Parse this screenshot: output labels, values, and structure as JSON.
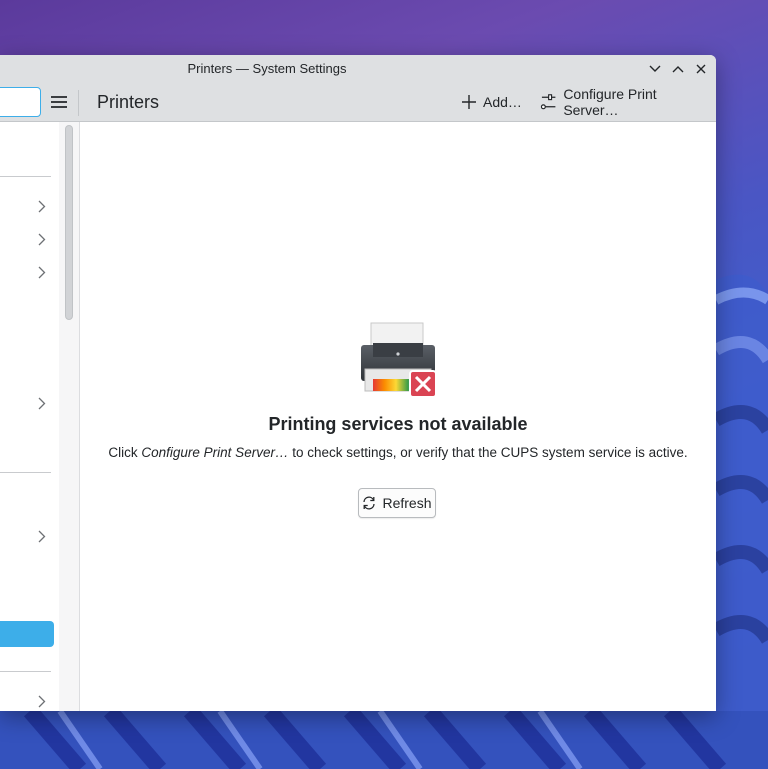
{
  "window": {
    "title": "Printers — System Settings"
  },
  "toolbar": {
    "page_title": "Printers",
    "add_label": "Add…",
    "configure_label": "Configure Print Server…"
  },
  "content": {
    "title": "Printing services not available",
    "body_prefix": "Click ",
    "body_italic": "Configure Print Server…",
    "body_suffix": " to check settings, or verify that the CUPS system service is active.",
    "refresh_label": "Refresh"
  },
  "colors": {
    "accent": "#3daee9",
    "window_chrome": "#dee0e2",
    "text": "#232629",
    "error_badge": "#da4453"
  },
  "icons": {
    "title_buttons": [
      "minimize-icon",
      "maximize-icon",
      "close-icon"
    ],
    "toolbar": [
      "hamburger-menu-icon",
      "plus-icon",
      "configure-icon"
    ],
    "content": [
      "printer-error-icon",
      "refresh-icon"
    ]
  }
}
